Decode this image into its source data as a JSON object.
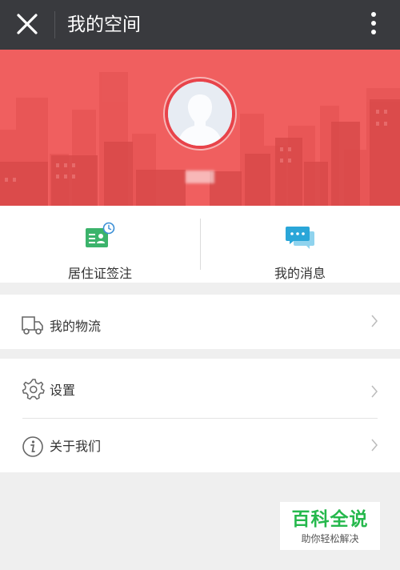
{
  "header": {
    "title": "我的空间",
    "close_icon": "close-icon",
    "more_icon": "more-vertical-icon"
  },
  "profile": {
    "avatar_icon": "default-avatar-icon"
  },
  "quick_actions": [
    {
      "label": "居住证签注",
      "icon": "residence-permit-icon",
      "color": "#3bb36b"
    },
    {
      "label": "我的消息",
      "icon": "chat-bubbles-icon",
      "color": "#2aa6d8"
    }
  ],
  "menu": {
    "logistics": {
      "label": "我的物流",
      "icon": "truck-icon"
    },
    "settings": {
      "label": "设置",
      "icon": "gear-icon"
    },
    "about": {
      "label": "关于我们",
      "icon": "info-icon"
    }
  },
  "watermark": {
    "title": "百科全说",
    "subtitle": "助你轻松解决"
  },
  "colors": {
    "topbar": "#393a3e",
    "banner": "#f05f5f",
    "avatar_ring": "#e8434a",
    "watermark_green": "#25b84c"
  }
}
